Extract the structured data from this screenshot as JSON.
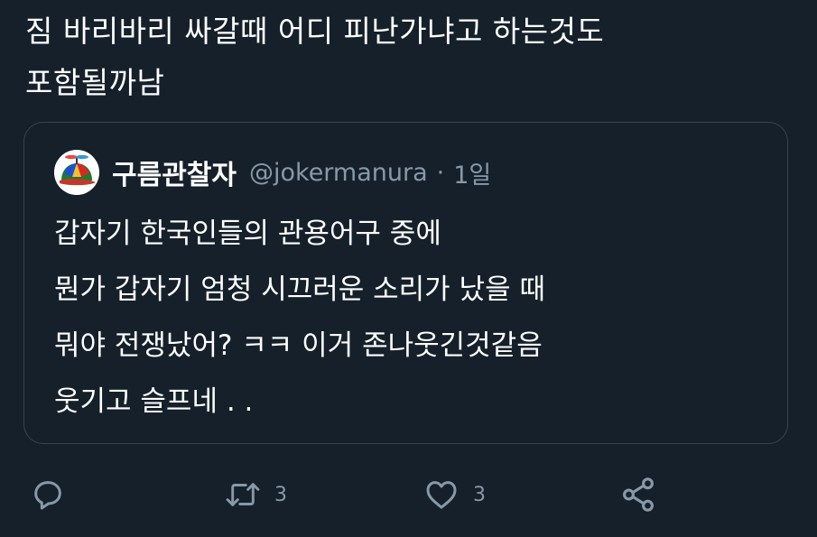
{
  "tweet": {
    "text_lines": [
      "짐 바리바리 싸갈때 어디 피난가냐고 하는것도",
      "포함될까남"
    ]
  },
  "quoted_tweet": {
    "author_name": "구름관찰자",
    "author_handle": "@jokermanura",
    "separator": "·",
    "time": "1일",
    "avatar_icon": "propeller-cap-icon",
    "body_lines": [
      "갑자기 한국인들의 관용어구 중에",
      "뭔가 갑자기 엄청 시끄러운 소리가 났을 때",
      "뭐야 전쟁났어? ㅋㅋ 이거 존나웃긴것같음",
      "웃기고 슬프네 . ."
    ]
  },
  "actions": {
    "reply_icon": "reply-icon",
    "retweet_icon": "retweet-icon",
    "retweet_count": "3",
    "like_icon": "heart-icon",
    "like_count": "3",
    "share_icon": "share-icon"
  },
  "colors": {
    "background": "#15202b",
    "border": "#38444d",
    "secondary_text": "#8899a6",
    "primary_text": "#ffffff"
  }
}
